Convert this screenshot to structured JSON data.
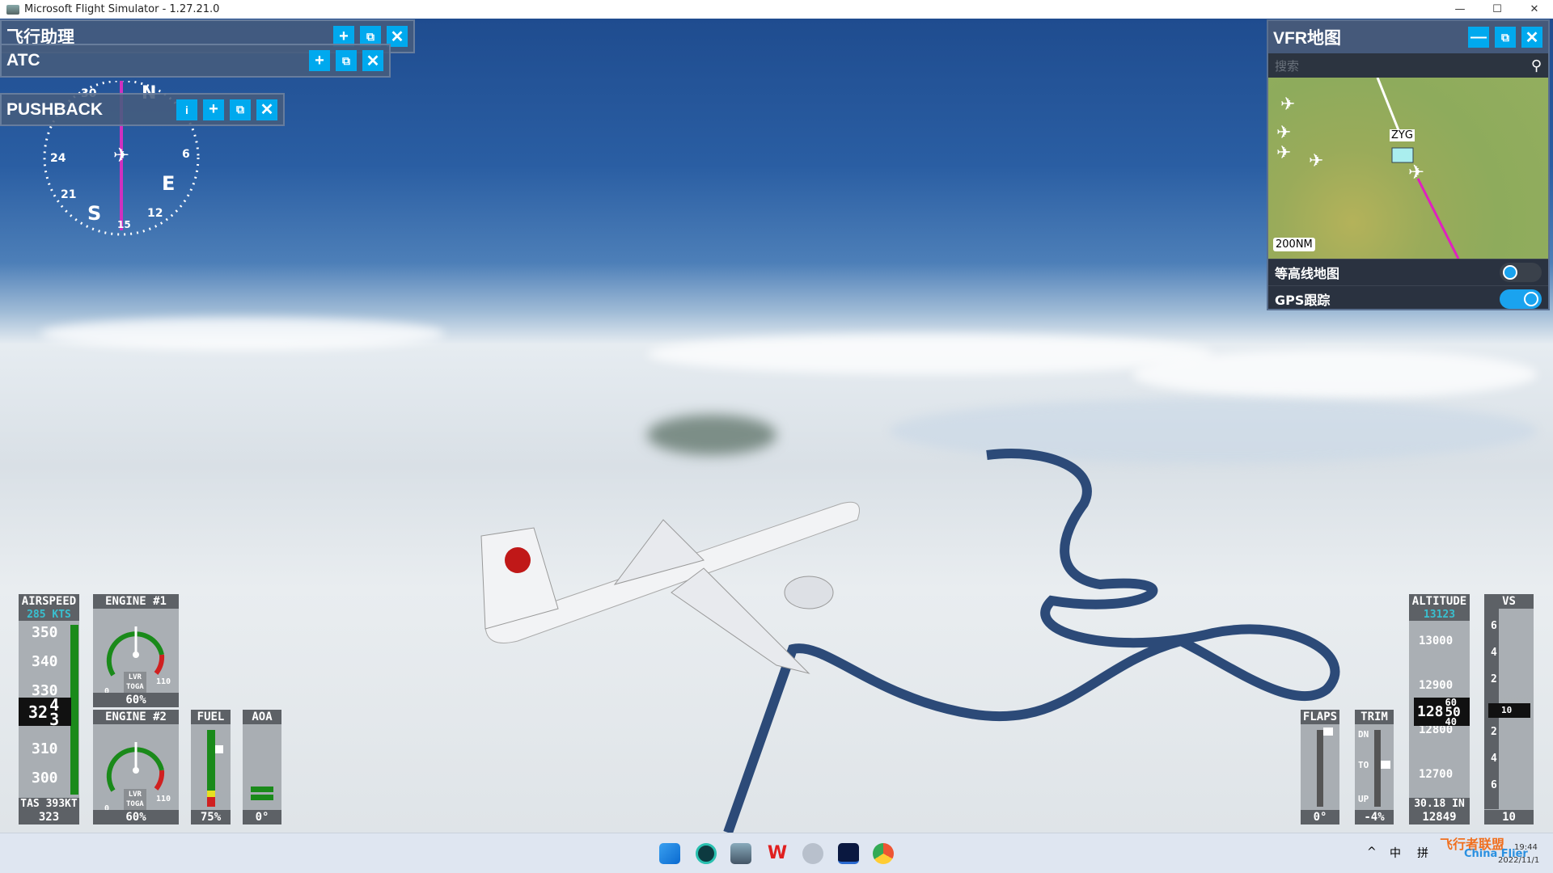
{
  "window": {
    "title": "Microsoft Flight Simulator - 1.27.21.0",
    "minimize": "—",
    "maximize": "☐",
    "close": "✕"
  },
  "panels": {
    "assistant": {
      "title": "飞行助理"
    },
    "atc": {
      "title": "ATC"
    },
    "pushback": {
      "title": "PUSHBACK",
      "info": "i"
    },
    "buttons": {
      "add": "+",
      "undock": "⧉",
      "close": "✕",
      "minimize": "—"
    }
  },
  "compass": {
    "labels": [
      "30",
      "N",
      "24",
      "6",
      "21",
      "E",
      "S",
      "15",
      "12"
    ]
  },
  "vfr_map": {
    "title": "VFR地图",
    "search_placeholder": "搜索",
    "airport": "ZYG",
    "scale": "200NM",
    "toggles": [
      {
        "label": "等高线地图",
        "on": false
      },
      {
        "label": "GPS跟踪",
        "on": true
      }
    ],
    "accent": "#00a9ee"
  },
  "airspeed": {
    "title": "AIRSPEED",
    "selected": "285 KTS",
    "ticks": [
      "350",
      "340",
      "330",
      "310",
      "300"
    ],
    "current_main": "32",
    "current_upper": "4",
    "current_lower": "3",
    "tas": "TAS 393KT",
    "value": "323"
  },
  "engine1": {
    "title": "ENGINE #1",
    "min": "0",
    "max": "110",
    "mode1": "LVR",
    "mode2": "TOGA",
    "value": "60%"
  },
  "engine2": {
    "title": "ENGINE #2",
    "min": "0",
    "max": "110",
    "mode1": "LVR",
    "mode2": "TOGA",
    "value": "60%"
  },
  "fuel": {
    "title": "FUEL",
    "value": "75%",
    "level": 0.75
  },
  "aoa": {
    "title": "AOA",
    "value": "0°"
  },
  "flaps": {
    "title": "FLAPS",
    "value": "0°"
  },
  "trim": {
    "title": "TRIM",
    "dn": "DN",
    "to": "TO",
    "up": "UP",
    "value": "-4%"
  },
  "altitude": {
    "title": "ALTITUDE",
    "selected": "13123",
    "ticks": [
      "13000",
      "12900",
      "12800",
      "12700"
    ],
    "current_main": "128",
    "current_upper": "60",
    "current_mid": "50",
    "current_lower": "40",
    "baro": "30.18 IN",
    "value": "12849"
  },
  "vs": {
    "title": "VS",
    "ticks": [
      "6",
      "4",
      "2",
      "2",
      "4",
      "6"
    ],
    "current": "10",
    "value": "10"
  },
  "taskbar": {
    "tray": [
      "^",
      "中",
      "拼"
    ],
    "time": "19:44",
    "date": "2022/11/1",
    "watermark": "飞行者联盟",
    "watermark2": "China Flier"
  }
}
